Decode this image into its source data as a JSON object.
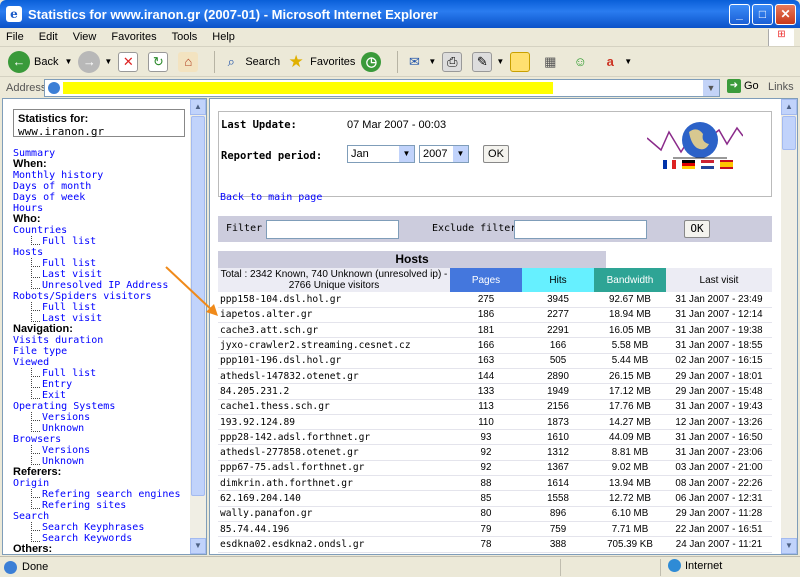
{
  "window": {
    "title": "Statistics for www.iranon.gr (2007-01) - Microsoft Internet Explorer"
  },
  "menu": [
    "File",
    "Edit",
    "View",
    "Favorites",
    "Tools",
    "Help"
  ],
  "toolbar": {
    "back": "Back",
    "search": "Search",
    "favorites": "Favorites"
  },
  "address": {
    "label": "Address",
    "go": "Go",
    "links": "Links"
  },
  "sidebar": {
    "stats_label": "Statistics for:",
    "site": "www.iranon.gr",
    "items": [
      {
        "t": "l",
        "text": "Summary"
      },
      {
        "t": "h",
        "text": "When:"
      },
      {
        "t": "l",
        "text": "Monthly history"
      },
      {
        "t": "l",
        "text": "Days of month"
      },
      {
        "t": "l",
        "text": "Days of week"
      },
      {
        "t": "l",
        "text": "Hours"
      },
      {
        "t": "h",
        "text": "Who:"
      },
      {
        "t": "l",
        "text": "Countries"
      },
      {
        "t": "s",
        "text": "Full list"
      },
      {
        "t": "l",
        "text": "Hosts"
      },
      {
        "t": "s",
        "text": "Full list"
      },
      {
        "t": "s",
        "text": "Last visit"
      },
      {
        "t": "s",
        "text": "Unresolved IP Address"
      },
      {
        "t": "l",
        "text": "Robots/Spiders visitors"
      },
      {
        "t": "s",
        "text": "Full list"
      },
      {
        "t": "s",
        "text": "Last visit"
      },
      {
        "t": "h",
        "text": "Navigation:"
      },
      {
        "t": "l",
        "text": "Visits duration"
      },
      {
        "t": "l",
        "text": "File type"
      },
      {
        "t": "l",
        "text": "Viewed"
      },
      {
        "t": "s",
        "text": "Full list"
      },
      {
        "t": "s",
        "text": "Entry"
      },
      {
        "t": "s",
        "text": "Exit"
      },
      {
        "t": "l",
        "text": "Operating Systems"
      },
      {
        "t": "s",
        "text": "Versions"
      },
      {
        "t": "s",
        "text": "Unknown"
      },
      {
        "t": "l",
        "text": "Browsers"
      },
      {
        "t": "s",
        "text": "Versions"
      },
      {
        "t": "s",
        "text": "Unknown"
      },
      {
        "t": "h",
        "text": "Referers:"
      },
      {
        "t": "l",
        "text": "Origin"
      },
      {
        "t": "s",
        "text": "Refering search engines"
      },
      {
        "t": "s",
        "text": "Refering sites"
      },
      {
        "t": "l",
        "text": "Search"
      },
      {
        "t": "s",
        "text": "Search Keyphrases"
      },
      {
        "t": "s",
        "text": "Search Keywords"
      },
      {
        "t": "h",
        "text": "Others:"
      }
    ]
  },
  "main": {
    "last_update_label": "Last Update:",
    "last_update_value": "07 Mar 2007 - 00:03",
    "period_label": "Reported period:",
    "month": "Jan",
    "year": "2007",
    "ok": "OK",
    "back_link": "Back to main page",
    "filter_label": "Filter :",
    "exclude_label": "Exclude filter :",
    "hosts_title": "Hosts",
    "total_text": "Total : 2342 Known, 740 Unknown (unresolved ip) - 2766 Unique visitors",
    "columns": [
      "Pages",
      "Hits",
      "Bandwidth",
      "Last visit"
    ],
    "rows": [
      [
        "ppp158-104.dsl.hol.gr",
        "275",
        "3945",
        "92.67 MB",
        "31 Jan 2007 - 23:49"
      ],
      [
        "iapetos.alter.gr",
        "186",
        "2277",
        "18.94 MB",
        "31 Jan 2007 - 12:14"
      ],
      [
        "cache3.att.sch.gr",
        "181",
        "2291",
        "16.05 MB",
        "31 Jan 2007 - 19:38"
      ],
      [
        "jyxo-crawler2.streaming.cesnet.cz",
        "166",
        "166",
        "5.58 MB",
        "31 Jan 2007 - 18:55"
      ],
      [
        "ppp101-196.dsl.hol.gr",
        "163",
        "505",
        "5.44 MB",
        "02 Jan 2007 - 16:15"
      ],
      [
        "athedsl-147832.otenet.gr",
        "144",
        "2890",
        "26.15 MB",
        "29 Jan 2007 - 18:01"
      ],
      [
        "84.205.231.2",
        "133",
        "1949",
        "17.12 MB",
        "29 Jan 2007 - 15:48"
      ],
      [
        "cache1.thess.sch.gr",
        "113",
        "2156",
        "17.76 MB",
        "31 Jan 2007 - 19:43"
      ],
      [
        "193.92.124.89",
        "110",
        "1873",
        "14.27 MB",
        "12 Jan 2007 - 13:26"
      ],
      [
        "ppp28-142.adsl.forthnet.gr",
        "93",
        "1610",
        "44.09 MB",
        "31 Jan 2007 - 16:50"
      ],
      [
        "athedsl-277858.otenet.gr",
        "92",
        "1312",
        "8.81 MB",
        "31 Jan 2007 - 23:06"
      ],
      [
        "ppp67-75.adsl.forthnet.gr",
        "92",
        "1367",
        "9.02 MB",
        "03 Jan 2007 - 21:00"
      ],
      [
        "dimkrin.ath.forthnet.gr",
        "88",
        "1614",
        "13.94 MB",
        "08 Jan 2007 - 22:26"
      ],
      [
        "62.169.204.140",
        "85",
        "1558",
        "12.72 MB",
        "06 Jan 2007 - 12:31"
      ],
      [
        "wally.panafon.gr",
        "80",
        "896",
        "6.10 MB",
        "29 Jan 2007 - 11:28"
      ],
      [
        "85.74.44.196",
        "79",
        "759",
        "7.71 MB",
        "22 Jan 2007 - 16:51"
      ],
      [
        "esdkna02.esdkna2.ondsl.gr",
        "78",
        "388",
        "705.39 KB",
        "24 Jan 2007 - 11:21"
      ]
    ]
  },
  "status": {
    "text": "Done",
    "zone": "Internet"
  },
  "colors": {
    "pages": "#4477dd",
    "hits": "#66f0ff",
    "bandwidth": "#2ea495",
    "highlight": "#ffff00"
  }
}
